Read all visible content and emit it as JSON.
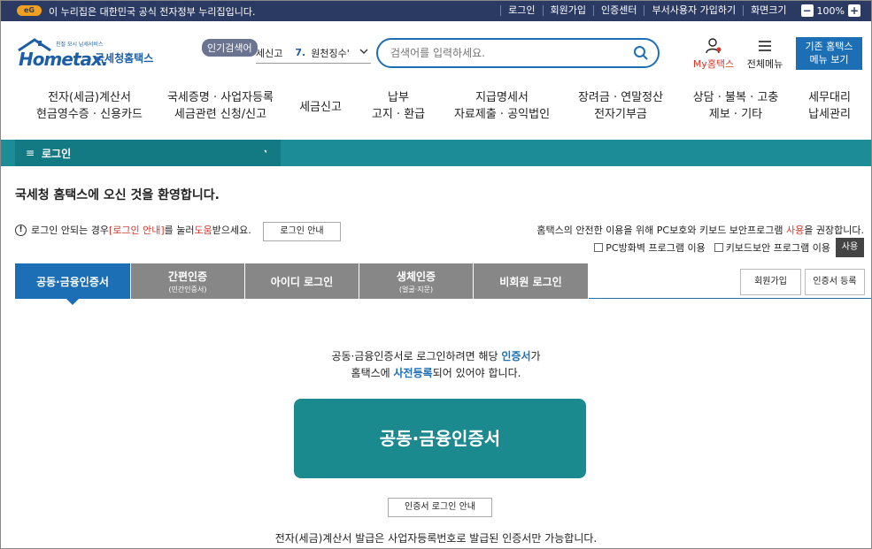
{
  "gov_bar": {
    "logo_text": "eG",
    "notice": "이 누리집은 대한민국 공식 전자정부 누리집입니다.",
    "links": [
      "로그인",
      "회원가입",
      "인증센터",
      "부서사용자 가입하기",
      "화면크기"
    ],
    "zoom_minus": "−",
    "zoom": "100%",
    "zoom_plus": "+"
  },
  "header": {
    "logo_small": "친절 모시 납세서비스",
    "logo_brand": "Hometax.",
    "logo_name": "국세청홈택스",
    "popular_label": "인기검색어",
    "popular_text": "세신고",
    "popular_num": "7.",
    "popular_term": "원천징수'",
    "search_placeholder": "검색어를 입력하세요.",
    "my_hometax": "My홈택스",
    "all_menu": "전체메뉴",
    "legacy_line1": "기존 홈택스",
    "legacy_line2": "메뉴 보기"
  },
  "nav": [
    {
      "l1": "전자(세금)계산서",
      "l2": "현금영수증 · 신용카드"
    },
    {
      "l1": "국세증명 · 사업자등록",
      "l2": "세금관련 신청/신고"
    },
    {
      "l1": "세금신고",
      "l2": ""
    },
    {
      "l1": "납부",
      "l2": "고지 · 환급"
    },
    {
      "l1": "지급명세서",
      "l2": "자료제출 · 공익법인"
    },
    {
      "l1": "장려금 · 연말정산",
      "l2": "전자기부금"
    },
    {
      "l1": "상담 · 불복 · 고충",
      "l2": "제보 · 기타"
    },
    {
      "l1": "세무대리",
      "l2": "납세관리"
    }
  ],
  "breadcrumb": {
    "menu_icon": "≡",
    "label": "로그인"
  },
  "welcome": "국세청 홈택스에 오신 것을 환영합니다.",
  "notice": {
    "prefix": "로그인 안되는 경우 ",
    "link": "[로그인 안내]",
    "middle": "를 눌러 ",
    "help": "도움",
    "suffix": "받으세요.",
    "button": "로그인 안내"
  },
  "safety": {
    "prefix": "홈택스의 안전한 이용을 위해 PC보호와 키보드 보안프로그램 ",
    "use": "사용",
    "suffix": "을 권장합니다.",
    "opt1": "PC방화벽 프로그램 이용",
    "opt2": "키보드보안 프로그램 이용",
    "use_button": "사용"
  },
  "tabs": [
    {
      "label": "공동·금융인증서",
      "sub": ""
    },
    {
      "label": "간편인증",
      "sub": "(민간인증서)"
    },
    {
      "label": "아이디 로그인",
      "sub": ""
    },
    {
      "label": "생체인증",
      "sub": "(얼굴·지문)"
    },
    {
      "label": "비회원 로그인",
      "sub": ""
    }
  ],
  "side_buttons": {
    "signup": "회원가입",
    "register": "인증서 등록"
  },
  "description": {
    "line1_a": "공동·금융인증서로 로그인하려면 해당 ",
    "line1_b": "인증서",
    "line1_c": "가",
    "line2_a": "홈택스에 ",
    "line2_b": "사전등록",
    "line2_c": "되어 있어야 합니다."
  },
  "big_button": "공동·금융인증서",
  "cert_guide": "인증서 로그인 안내",
  "footnote": "전자(세금)계산서 발급은 사업자등록번호로 발급된 인증서만 가능합니다.",
  "colors": {
    "primary": "#1c6fb5",
    "teal": "#1a8a8f",
    "govbar": "#2b3a63",
    "accent_red": "#d03a2c"
  }
}
